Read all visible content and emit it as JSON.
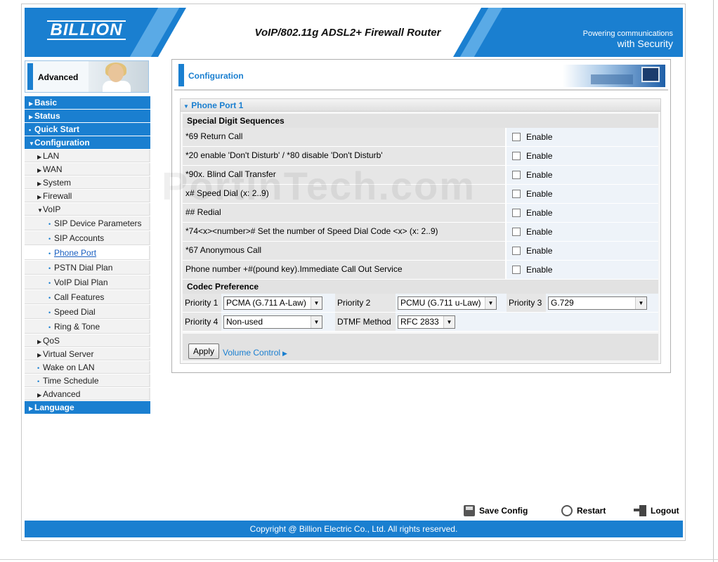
{
  "header": {
    "logo": "BILLION",
    "product_title": "VoIP/802.11g ADSL2+ Firewall Router",
    "tagline_line1": "Powering communications",
    "tagline_line2": "with Security"
  },
  "sidebar": {
    "mode_label": "Advanced",
    "items": [
      {
        "label": "Basic",
        "level": "top",
        "icon": "right-arrow"
      },
      {
        "label": "Status",
        "level": "top",
        "icon": "right-arrow"
      },
      {
        "label": "Quick Start",
        "level": "top",
        "icon": "dot"
      },
      {
        "label": "Configuration",
        "level": "top",
        "icon": "down-arrow"
      },
      {
        "label": "LAN",
        "level": "sub",
        "icon": "right-arrow"
      },
      {
        "label": "WAN",
        "level": "sub",
        "icon": "right-arrow"
      },
      {
        "label": "System",
        "level": "sub",
        "icon": "right-arrow"
      },
      {
        "label": "Firewall",
        "level": "sub",
        "icon": "right-arrow"
      },
      {
        "label": "VoIP",
        "level": "sub",
        "icon": "down-arrow"
      },
      {
        "label": "SIP Device Parameters",
        "level": "subsub",
        "icon": "dot"
      },
      {
        "label": "SIP Accounts",
        "level": "subsub",
        "icon": "dot"
      },
      {
        "label": "Phone Port",
        "level": "subsub",
        "icon": "dot",
        "active": true
      },
      {
        "label": "PSTN Dial Plan",
        "level": "subsub",
        "icon": "dot"
      },
      {
        "label": "VoIP Dial Plan",
        "level": "subsub",
        "icon": "dot"
      },
      {
        "label": "Call Features",
        "level": "subsub",
        "icon": "dot"
      },
      {
        "label": "Speed Dial",
        "level": "subsub",
        "icon": "dot"
      },
      {
        "label": "Ring & Tone",
        "level": "subsub",
        "icon": "dot"
      },
      {
        "label": "QoS",
        "level": "sub",
        "icon": "right-arrow"
      },
      {
        "label": "Virtual Server",
        "level": "sub",
        "icon": "right-arrow"
      },
      {
        "label": "Wake on LAN",
        "level": "sub",
        "icon": "dot"
      },
      {
        "label": "Time Schedule",
        "level": "sub",
        "icon": "dot"
      },
      {
        "label": "Advanced",
        "level": "sub",
        "icon": "right-arrow"
      },
      {
        "label": "Language",
        "level": "top",
        "icon": "right-arrow"
      }
    ]
  },
  "main": {
    "title": "Configuration",
    "panel_title": "Phone Port 1",
    "special_digits_heading": "Special Digit Sequences",
    "enable_label": "Enable",
    "sequences": [
      {
        "label": "*69 Return Call",
        "checked": false
      },
      {
        "label": "*20 enable 'Don't Disturb' / *80 disable 'Don't Disturb'",
        "checked": false
      },
      {
        "label": "*90x. Blind Call Transfer",
        "checked": false
      },
      {
        "label": "x# Speed Dial (x: 2..9)",
        "checked": false
      },
      {
        "label": "## Redial",
        "checked": false
      },
      {
        "label": "*74<x><number># Set the number of Speed Dial Code <x> (x: 2..9)",
        "checked": false
      },
      {
        "label": "*67 Anonymous Call",
        "checked": false
      },
      {
        "label": "Phone number +#(pound key).Immediate Call Out Service",
        "checked": false
      }
    ],
    "codec_heading": "Codec Preference",
    "priority1_label": "Priority 1",
    "priority1_value": "PCMA (G.711 A-Law)",
    "priority2_label": "Priority 2",
    "priority2_value": "PCMU (G.711 u-Law)",
    "priority3_label": "Priority 3",
    "priority3_value": "G.729",
    "priority4_label": "Priority 4",
    "priority4_value": "Non-used",
    "dtmf_label": "DTMF Method",
    "dtmf_value": "RFC 2833",
    "apply_label": "Apply",
    "volume_link": "Volume Control"
  },
  "watermark": "PortInTech.com",
  "bottom": {
    "save_config": "Save Config",
    "restart": "Restart",
    "logout": "Logout"
  },
  "footer": {
    "copyright": "Copyright @ Billion Electric Co., Ltd. All rights reserved."
  },
  "colors": {
    "brand_blue": "#1a7fd0",
    "link_blue": "#1a5fc0"
  }
}
